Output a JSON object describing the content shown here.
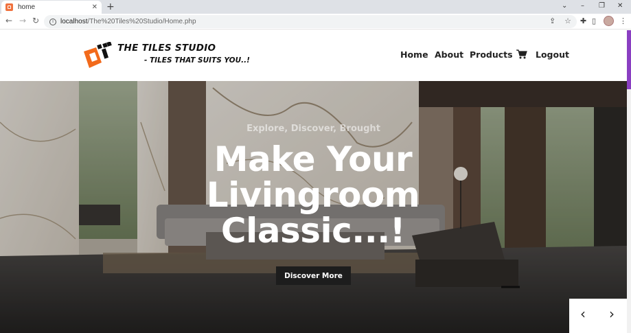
{
  "browser": {
    "tab_title": "home",
    "tab_close": "✕",
    "new_tab": "+",
    "url_host": "localhost",
    "url_path": "/The%20Tiles%20Studio/Home.php",
    "window_controls": [
      "⌄",
      "–",
      "❐",
      "✕"
    ]
  },
  "site": {
    "brand": "THE TILES STUDIO",
    "tagline": "- TILES THAT SUITS YOU..!",
    "nav": [
      "Home",
      "About",
      "Products",
      "Logout"
    ],
    "accent": "#f26a1b"
  },
  "hero": {
    "subtitle": "Explore, Discover, Brought",
    "title_lines": [
      "Make Your",
      "Livingroom",
      "Classic...!"
    ],
    "button": "Discover More",
    "prev": "‹",
    "next": "›"
  }
}
